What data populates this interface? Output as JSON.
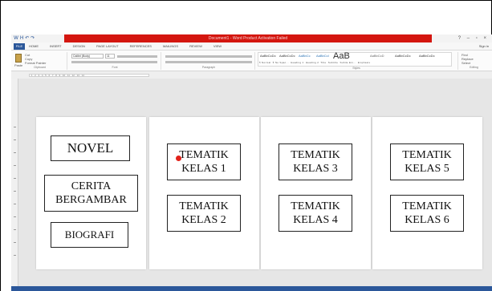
{
  "window": {
    "title": "Document1 - Word Product Activation Failed",
    "controls": "?  –  ▫  ×",
    "quick_access": "W  H  ↶  ↷",
    "signin": "Sign in"
  },
  "tabs": {
    "file": "FILE",
    "items": [
      "HOME",
      "INSERT",
      "DESIGN",
      "PAGE LAYOUT",
      "REFERENCES",
      "MAILINGS",
      "REVIEW",
      "VIEW"
    ]
  },
  "ribbon": {
    "clipboard": {
      "paste": "Paste",
      "cut": "Cut",
      "copy": "Copy",
      "format_painter": "Format Painter",
      "caption": "Clipboard"
    },
    "font": {
      "family": "Calibri (Body)",
      "size": "11",
      "caption": "Font"
    },
    "paragraph": {
      "caption": "Paragraph"
    },
    "styles": {
      "caption": "Styles",
      "samples": [
        "AaBbCcDc",
        "AaBbCcDc",
        "AaBbCc",
        "AaBbCcI",
        "AaB",
        "AaBbCcD",
        "AaBbCcDc",
        "AaBbCcDc"
      ],
      "names": [
        "¶ Normal",
        "¶ No Spac...",
        "Heading 1",
        "Heading 2",
        "Title",
        "Subtitle",
        "Subtle Em...",
        "Emphasis"
      ]
    },
    "editing": {
      "find": "Find",
      "replace": "Replace",
      "select": "Select",
      "caption": "Editing"
    }
  },
  "pages": [
    {
      "cards": [
        "NOVEL",
        "CERITA\nBERGAMBAR",
        "BIOGRAFI"
      ]
    },
    {
      "cards": [
        "TEMATIK\nKELAS 1",
        "TEMATIK\nKELAS 2"
      ]
    },
    {
      "cards": [
        "TEMATIK\nKELAS 3",
        "TEMATIK\nKELAS 4"
      ]
    },
    {
      "cards": [
        "TEMATIK\nKELAS 5",
        "TEMATIK\nKELAS 6"
      ]
    }
  ],
  "colors": {
    "accent": "#2b579a",
    "title_bar": "#d4160f",
    "pointer": "#e2221b"
  }
}
